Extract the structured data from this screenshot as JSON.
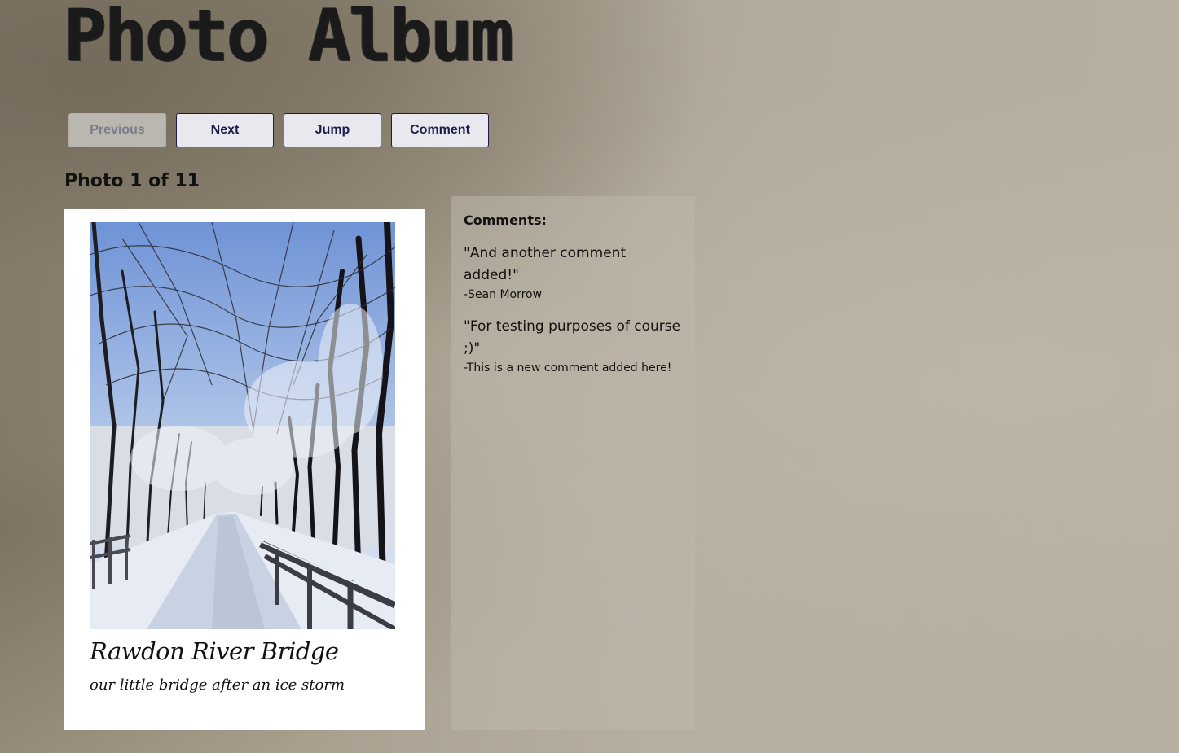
{
  "header": {
    "title": "Photo Album"
  },
  "toolbar": {
    "previous_label": "Previous",
    "next_label": "Next",
    "jump_label": "Jump",
    "comment_label": "Comment",
    "previous_disabled": true
  },
  "counter": {
    "text": "Photo 1 of 11",
    "current": 1,
    "total": 11
  },
  "photo": {
    "title": "Rawdon River Bridge",
    "caption": "our little bridge after an ice storm",
    "image_description": "snow-covered path and wooden bridge under icy trees"
  },
  "comments": {
    "heading": "Comments:",
    "items": [
      {
        "text": "\"And another comment added!\"",
        "author": "-Sean Morrow"
      },
      {
        "text": "\"For testing purposes of course ;)\"",
        "author": "-This is a new comment added here!"
      }
    ]
  },
  "colors": {
    "button_border": "#1e1b4b",
    "button_bg": "#e8e8ee",
    "background": "#a59d8d"
  }
}
